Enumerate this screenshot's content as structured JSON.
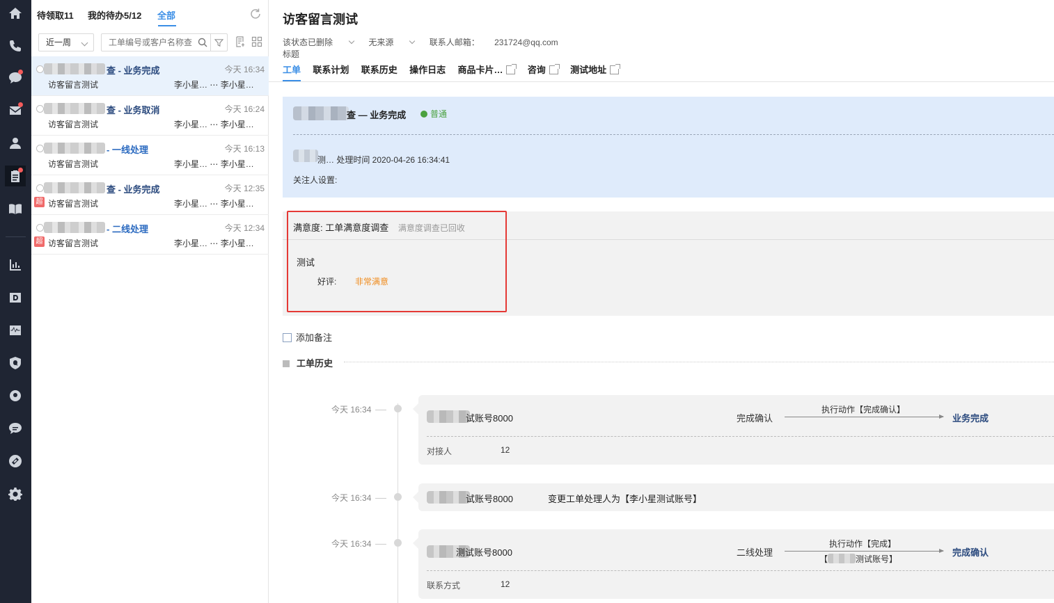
{
  "sidebar": {
    "icons": [
      "home-icon",
      "phone-icon",
      "chat-icon",
      "mail-icon",
      "user-icon",
      "ticket-icon",
      "book-icon",
      "stats-icon",
      "data-icon",
      "monitor-icon",
      "quality-icon",
      "bulb-icon",
      "message-icon",
      "link-icon",
      "settings-icon"
    ],
    "active": "ticket-icon",
    "badges": [
      "chat-icon",
      "mail-icon",
      "ticket-icon"
    ]
  },
  "list": {
    "tabs": [
      {
        "label": "待领取11"
      },
      {
        "label": "我的待办5/12"
      },
      {
        "label": "全部"
      }
    ],
    "filter_period": "近一周",
    "search_placeholder": "工单编号或客户名称查",
    "items": [
      {
        "title": "查 - 业务完成",
        "time": "今天 16:34",
        "desc": "访客留言测试",
        "assignee": "李小星…",
        "handler": "李小星…",
        "overdue": ""
      },
      {
        "title": "查 - 业务取消",
        "time": "今天 16:24",
        "desc": "访客留言测试",
        "assignee": "李小星…",
        "handler": "李小星…",
        "overdue": ""
      },
      {
        "title": "- 一线处理",
        "time": "今天 16:13",
        "desc": "访客留言测试",
        "assignee": "李小星…",
        "handler": "李小星…",
        "overdue": ""
      },
      {
        "title": "查 - 业务完成",
        "time": "今天 12:35",
        "desc": "访客留言测试",
        "assignee": "李小星…",
        "handler": "李小星…",
        "overdue": "超"
      },
      {
        "title": "- 二线处理",
        "time": "今天 12:34",
        "desc": "访客留言测试",
        "assignee": "李小星…",
        "handler": "李小星…",
        "overdue": "超"
      }
    ]
  },
  "main": {
    "title": "访客留言测试",
    "meta": {
      "status": "该状态已删除",
      "source": "无来源",
      "email_label": "联系人邮箱：",
      "email": "231724@qq.com",
      "subtitle": "标题"
    },
    "tabs": [
      {
        "label": "工单",
        "external": false
      },
      {
        "label": "联系计划",
        "external": false
      },
      {
        "label": "联系历史",
        "external": false
      },
      {
        "label": "操作日志",
        "external": false
      },
      {
        "label": "商品卡片…",
        "external": true
      },
      {
        "label": "咨询",
        "external": true
      },
      {
        "label": "测试地址",
        "external": true
      }
    ],
    "summary": {
      "title": "查 — 业务完成",
      "priority": "普通",
      "line1": "测…   处理时间  2020-04-26 16:34:41",
      "followers": "关注人设置:"
    },
    "satisfaction": {
      "label": "满意度:",
      "survey": "工单满意度调查",
      "status": "满意度调查已回收",
      "question": "测试",
      "answer_label": "好评:",
      "answer": "非常满意"
    },
    "add_note": "添加备注",
    "history_title": "工单历史",
    "history": [
      {
        "time": "今天 16:34",
        "name": "试账号8000",
        "from": "完成确认",
        "action": "执行动作【完成确认】",
        "to": "业务完成",
        "field_label": "对接人",
        "field_value": "12"
      },
      {
        "time": "今天 16:34",
        "name": "试账号8000",
        "message": "变更工单处理人为【李小星测试账号】"
      },
      {
        "time": "今天 16:34",
        "name": "测试账号8000",
        "from": "二线处理",
        "action": "执行动作【完成】",
        "action2": "测试账号】",
        "to": "完成确认",
        "field_label": "联系方式",
        "field_value": "12"
      }
    ]
  }
}
